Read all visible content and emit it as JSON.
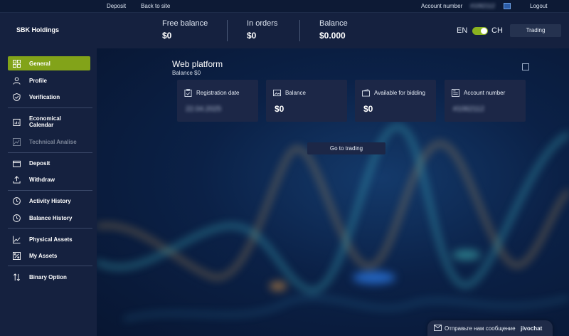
{
  "topbar": {
    "deposit_link": "Deposit",
    "back_link": "Back to site",
    "account_label": "Account number",
    "account_value": "#1062112",
    "logout_link": "Logout"
  },
  "header": {
    "brand": "SBK Holdings",
    "free_balance_label": "Free balance",
    "free_balance_value": "$0",
    "in_orders_label": "In orders",
    "in_orders_value": "$0",
    "balance_label": "Balance",
    "balance_value": "$0.000",
    "lang_en": "EN",
    "lang_ch": "CH",
    "trading_button": "Trading"
  },
  "sidebar": {
    "items": [
      {
        "label": "General",
        "icon": "grid-icon"
      },
      {
        "label": "Profile",
        "icon": "user-icon"
      },
      {
        "label": "Verification",
        "icon": "shield-check-icon"
      },
      {
        "label": "Economical Calendar",
        "icon": "calendar-chart-icon"
      },
      {
        "label": "Technical Analise",
        "icon": "analysis-icon"
      },
      {
        "label": "Deposit",
        "icon": "wallet-icon"
      },
      {
        "label": "Withdraw",
        "icon": "upload-icon"
      },
      {
        "label": "Activity History",
        "icon": "clock-icon"
      },
      {
        "label": "Balance History",
        "icon": "clock-icon"
      },
      {
        "label": "Physical Assets",
        "icon": "line-chart-icon"
      },
      {
        "label": "My Assets",
        "icon": "percent-icon"
      },
      {
        "label": "Binary Option",
        "icon": "swap-arrows-icon"
      }
    ]
  },
  "main": {
    "title": "Web platform",
    "subtitle": "Balance $0",
    "cards": [
      {
        "label": "Registration date",
        "value": "22.04.2025",
        "icon": "clipboard-check-icon"
      },
      {
        "label": "Balance",
        "value": "$0",
        "icon": "image-icon"
      },
      {
        "label": "Available for bidding",
        "value": "$0",
        "icon": "wallet-icon"
      },
      {
        "label": "Account number",
        "value": "#1062112",
        "icon": "document-icon"
      }
    ],
    "goto_button": "Go to trading"
  },
  "chat": {
    "text": "Отправьте нам сообщение",
    "brand": "jivochat"
  },
  "colors": {
    "accent": "#82a319",
    "toggle": "#8ab220",
    "panel": "#15213f",
    "card": "#1c2747"
  }
}
